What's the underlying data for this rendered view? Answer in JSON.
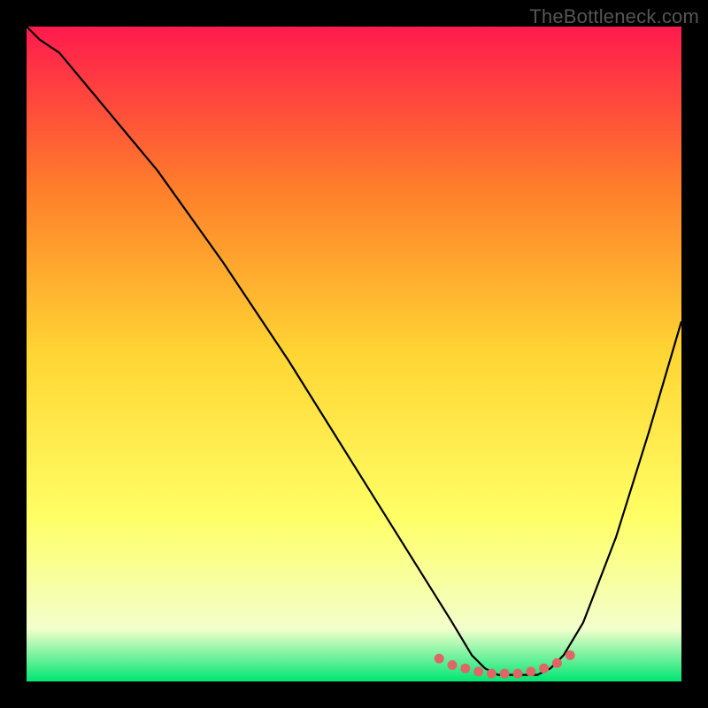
{
  "watermark": "TheBottleneck.com",
  "chart_data": {
    "type": "line",
    "title": "",
    "xlabel": "",
    "ylabel": "",
    "xlim": [
      0,
      100
    ],
    "ylim": [
      0,
      100
    ],
    "background_gradient": {
      "top": "#ff1a4d",
      "upper_mid": "#ff7f2a",
      "mid": "#ffd633",
      "lower_mid": "#ffff66",
      "near_bottom": "#f2ffcc",
      "bottom": "#00e673"
    },
    "series": [
      {
        "name": "bottleneck-curve",
        "color": "#000000",
        "x": [
          0,
          2,
          5,
          10,
          20,
          30,
          40,
          50,
          60,
          65,
          68,
          70,
          72,
          74,
          76,
          78,
          80,
          82,
          85,
          90,
          95,
          100
        ],
        "y": [
          100,
          98,
          96,
          90,
          78,
          64,
          49,
          33,
          17,
          9,
          4,
          2,
          1,
          1,
          1,
          1,
          2,
          4,
          9,
          22,
          38,
          55
        ]
      }
    ],
    "markers": {
      "name": "optimal-zone",
      "color": "#e06666",
      "x": [
        63,
        65,
        67,
        69,
        71,
        73,
        75,
        77,
        79,
        81,
        83
      ],
      "y": [
        3.5,
        2.5,
        2.0,
        1.5,
        1.2,
        1.2,
        1.2,
        1.5,
        2.0,
        2.8,
        4.0
      ]
    }
  }
}
